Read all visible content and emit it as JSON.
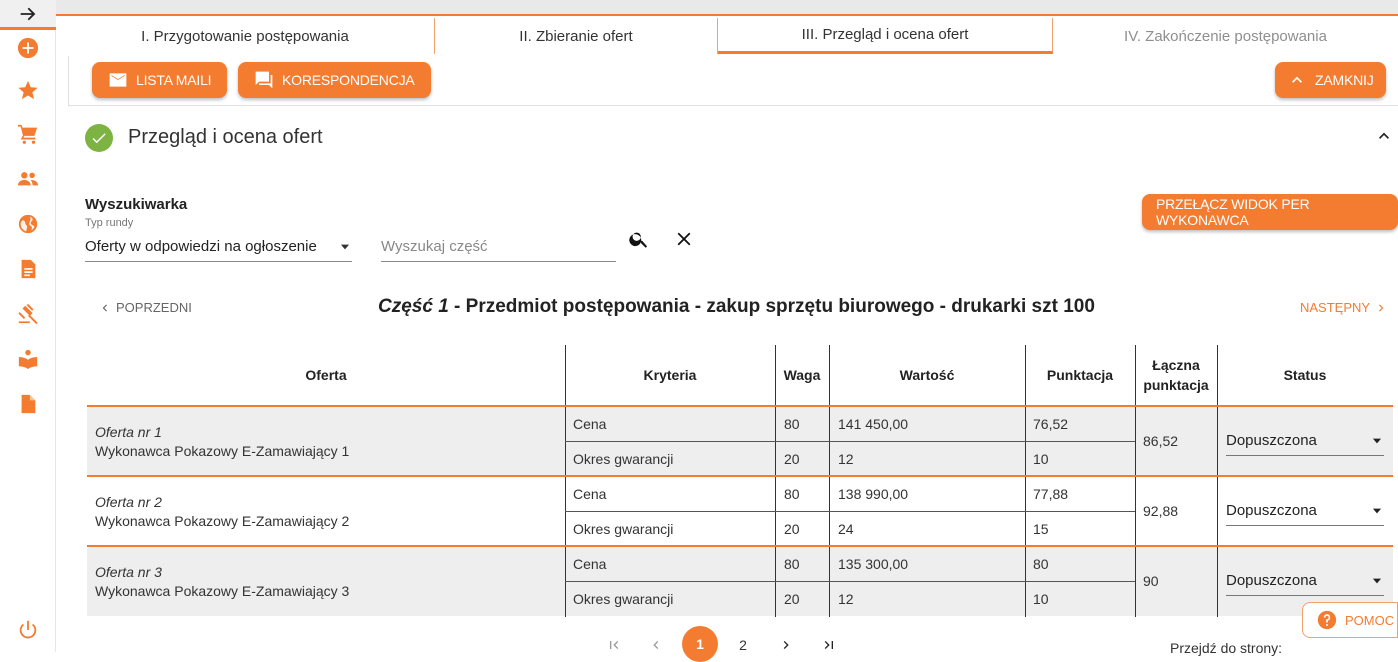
{
  "sidebar": {
    "icons": [
      "arrow-right-icon",
      "add-circle-icon",
      "star-icon",
      "cart-icon",
      "people-icon",
      "globe-icon",
      "document-icon",
      "gavel-icon",
      "reader-icon",
      "file-icon",
      "power-icon"
    ]
  },
  "steps": [
    {
      "label": "I. Przygotowanie postępowania"
    },
    {
      "label": "II. Zbieranie ofert"
    },
    {
      "label": "III. Przegląd i ocena ofert"
    },
    {
      "label": "IV. Zakończenie postępowania"
    }
  ],
  "actions": {
    "mail_list": "LISTA MAILI",
    "correspondence": "KORESPONDENCJA",
    "close": "ZAMKNIJ"
  },
  "section": {
    "title": "Przegląd i ocena ofert"
  },
  "search": {
    "title": "Wyszukiwarka",
    "round_label": "Typ rundy",
    "round_value": "Oferty w odpowiedzi na ogłoszenie",
    "part_placeholder": "Wyszukaj część",
    "switch_view": "PRZEŁĄCZ WIDOK PER WYKONAWCA"
  },
  "part_nav": {
    "prev": "POPRZEDNI",
    "next": "NASTĘPNY",
    "part_label": "Część 1",
    "part_rest": " - Przedmiot postępowania - zakup sprzętu biurowego - drukarki szt 100"
  },
  "table": {
    "headers": {
      "offer": "Oferta",
      "criteria": "Kryteria",
      "weight": "Waga",
      "value": "Wartość",
      "points": "Punktacja",
      "total_1": "Łączna",
      "total_2": "punktacja",
      "status": "Status"
    },
    "rows": [
      {
        "offer_no": "Oferta nr 1",
        "contractor": "Wykonawca Pokazowy E-Zamawiający 1",
        "c1": "Cena",
        "w1": "80",
        "v1": "141 450,00",
        "p1": "76,52",
        "c2": "Okres gwarancji",
        "w2": "20",
        "v2": "12",
        "p2": "10",
        "total": "86,52",
        "status": "Dopuszczona"
      },
      {
        "offer_no": "Oferta nr 2",
        "contractor": "Wykonawca Pokazowy E-Zamawiający 2",
        "c1": "Cena",
        "w1": "80",
        "v1": "138 990,00",
        "p1": "77,88",
        "c2": "Okres gwarancji",
        "w2": "20",
        "v2": "24",
        "p2": "15",
        "total": "92,88",
        "status": "Dopuszczona"
      },
      {
        "offer_no": "Oferta nr 3",
        "contractor": "Wykonawca Pokazowy E-Zamawiający 3",
        "c1": "Cena",
        "w1": "80",
        "v1": "135 300,00",
        "p1": "80",
        "c2": "Okres gwarancji",
        "w2": "20",
        "v2": "12",
        "p2": "10",
        "total": "90",
        "status": "Dopuszczona"
      }
    ]
  },
  "pagination": {
    "current": "1",
    "page2": "2",
    "goto_label": "Przejdź do strony:"
  },
  "help": {
    "label": "POMOC"
  },
  "colors": {
    "accent": "#f47c30",
    "success": "#7cb342",
    "row_alt": "#eeeeee"
  }
}
